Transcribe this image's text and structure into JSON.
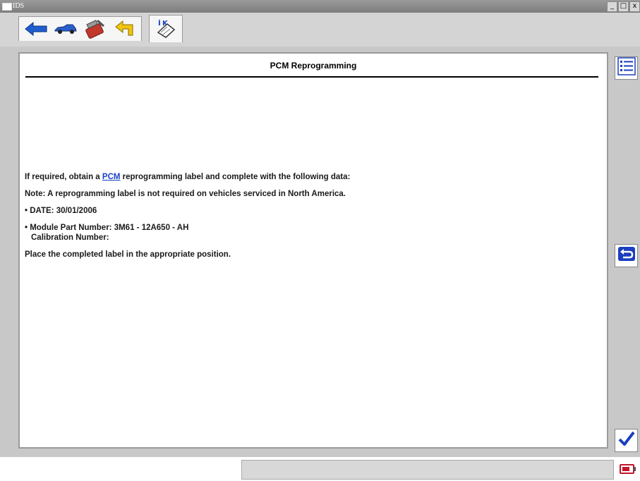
{
  "window": {
    "title": "IDS",
    "minimize": "_",
    "maximize": "□",
    "close": "x"
  },
  "toolbar": {
    "icons": [
      "back-arrow-icon",
      "vehicle-icon",
      "toolbox-icon",
      "yellow-arrow-icon"
    ],
    "active_tab_icon": "reprogramming-label-icon"
  },
  "main": {
    "heading": "PCM Reprogramming",
    "line1_before": "If required, obtain a ",
    "line1_link": "PCM",
    "line1_after": " reprogramming label and complete with the following data:",
    "note": "Note: A reprogramming label is not required on vehicles serviced in North America.",
    "date": "• DATE: 30/01/2006",
    "module_part": "• Module Part Number: 3M61 - 12A650 - AH",
    "calibration": "Calibration Number:",
    "place": "Place the completed label in the appropriate position."
  },
  "colors": {
    "accent_blue": "#1a40c8",
    "tick_blue": "#1a3fbf"
  },
  "right_panel": {
    "icons": [
      "list-icon",
      "return-icon",
      "checkmark-icon"
    ]
  },
  "status": {
    "icon": "battery-indicator-icon"
  }
}
